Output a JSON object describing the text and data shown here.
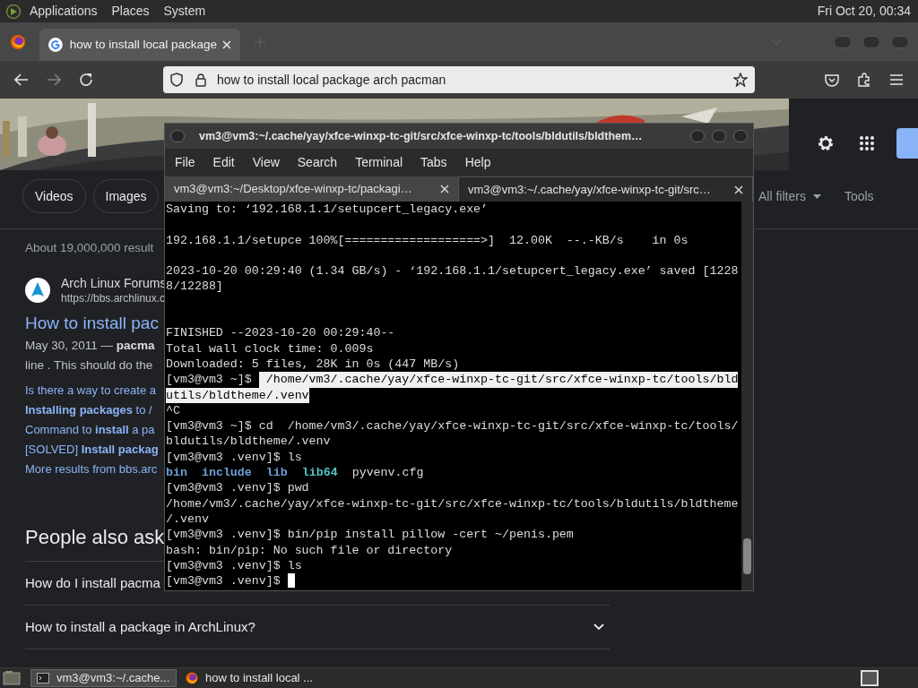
{
  "top_panel": {
    "menus": [
      "Applications",
      "Places",
      "System"
    ],
    "clock": "Fri Oct 20, 00:34"
  },
  "browser": {
    "tabs": [
      {
        "title": "how to install local package",
        "selected": true
      }
    ],
    "address": "how to install local package arch pacman",
    "page": {
      "chips": [
        "Videos",
        "Images"
      ],
      "filters": [
        "All filters",
        "Tools"
      ],
      "result_stats": "About 19,000,000 result",
      "result": {
        "site": "Arch Linux Forums",
        "url": "https://bbs.archlinux.c",
        "title": "How to install pac",
        "snippet": [
          "May 30, 2011 — **pacma**",
          "line . This should do the"
        ],
        "sitelinks": [
          "Is there a way to create a",
          "**Installing packages** to /",
          "Command to **install** a pa",
          "[SOLVED] **Install packag**",
          "More results from bbs.arc"
        ]
      },
      "people_also_ask": {
        "heading": "People also ask",
        "questions": [
          {
            "kind": "covered",
            "text": "How do I install pacma"
          },
          {
            "kind": "full",
            "text": "How to install a package in ArchLinux?"
          }
        ]
      }
    }
  },
  "terminal": {
    "title": "vm3@vm3:~/.cache/yay/xfce-winxp-tc-git/src/xfce-winxp-tc/tools/bldutils/bldthem…",
    "menus": [
      "File",
      "Edit",
      "View",
      "Search",
      "Terminal",
      "Tabs",
      "Help"
    ],
    "tabs": [
      {
        "title": "vm3@vm3:~/Desktop/xfce-winxp-tc/packagi…",
        "selected": false
      },
      {
        "title": "vm3@vm3:~/.cache/yay/xfce-winxp-tc-git/src…",
        "selected": true
      }
    ],
    "lines": [
      {
        "kind": "text",
        "segments": [
          {
            "kind": "plain",
            "text": "Saving to: ‘192.168.1.1/setupcert_legacy.exe’"
          }
        ]
      },
      {
        "kind": "blank"
      },
      {
        "kind": "text",
        "segments": [
          {
            "kind": "plain",
            "text": "192.168.1.1/setupce 100%[===================>]  12.00K  --.-KB/s    in 0s"
          }
        ]
      },
      {
        "kind": "blank"
      },
      {
        "kind": "text",
        "segments": [
          {
            "kind": "plain",
            "text": "2023-10-20 00:29:40 (1.34 GB/s) - ‘192.168.1.1/setupcert_legacy.exe’ saved [1228"
          }
        ]
      },
      {
        "kind": "text",
        "segments": [
          {
            "kind": "plain",
            "text": "8/12288]"
          }
        ]
      },
      {
        "kind": "blank"
      },
      {
        "kind": "blank"
      },
      {
        "kind": "text",
        "segments": [
          {
            "kind": "plain",
            "text": "FINISHED --2023-10-20 00:29:40--"
          }
        ]
      },
      {
        "kind": "text",
        "segments": [
          {
            "kind": "plain",
            "text": "Total wall clock time: 0.009s"
          }
        ]
      },
      {
        "kind": "text",
        "segments": [
          {
            "kind": "plain",
            "text": "Downloaded: 5 files, 28K in 0s (447 MB/s)"
          }
        ]
      },
      {
        "kind": "text",
        "segments": [
          {
            "kind": "plain",
            "text": "[vm3@vm3 ~]$ "
          },
          {
            "kind": "selected",
            "text": " /home/vm3/.cache/yay/xfce-winxp-tc-git/src/xfce-winxp-tc/tools/bld"
          }
        ]
      },
      {
        "kind": "text",
        "segments": [
          {
            "kind": "selected",
            "text": "utils/bldtheme/.venv"
          }
        ]
      },
      {
        "kind": "text",
        "segments": [
          {
            "kind": "plain",
            "text": "^C"
          }
        ]
      },
      {
        "kind": "text",
        "segments": [
          {
            "kind": "plain",
            "text": "[vm3@vm3 ~]$ cd  /home/vm3/.cache/yay/xfce-winxp-tc-git/src/xfce-winxp-tc/tools/"
          }
        ]
      },
      {
        "kind": "text",
        "segments": [
          {
            "kind": "plain",
            "text": "bldutils/bldtheme/.venv"
          }
        ]
      },
      {
        "kind": "text",
        "segments": [
          {
            "kind": "plain",
            "text": "[vm3@vm3 .venv]$ ls"
          }
        ]
      },
      {
        "kind": "text",
        "segments": [
          {
            "kind": "dir",
            "text": "bin"
          },
          {
            "kind": "dir",
            "text": "include"
          },
          {
            "kind": "dir",
            "text": "lib"
          },
          {
            "kind": "link",
            "text": "lib64"
          },
          {
            "kind": "plain",
            "text": "pyvenv.cfg"
          }
        ]
      },
      {
        "kind": "text",
        "segments": [
          {
            "kind": "plain",
            "text": "[vm3@vm3 .venv]$ pwd"
          }
        ]
      },
      {
        "kind": "text",
        "segments": [
          {
            "kind": "plain",
            "text": "/home/vm3/.cache/yay/xfce-winxp-tc-git/src/xfce-winxp-tc/tools/bldutils/bldtheme"
          }
        ]
      },
      {
        "kind": "text",
        "segments": [
          {
            "kind": "plain",
            "text": "/.venv"
          }
        ]
      },
      {
        "kind": "text",
        "segments": [
          {
            "kind": "plain",
            "text": "[vm3@vm3 .venv]$ bin/pip install pillow -cert ~/penis.pem"
          }
        ]
      },
      {
        "kind": "text",
        "segments": [
          {
            "kind": "plain",
            "text": "bash: bin/pip: No such file or directory"
          }
        ]
      },
      {
        "kind": "text",
        "segments": [
          {
            "kind": "plain",
            "text": "[vm3@vm3 .venv]$ ls"
          }
        ]
      },
      {
        "kind": "text",
        "cursor": true,
        "segments": [
          {
            "kind": "plain",
            "text": "[vm3@vm3 .venv]$ "
          }
        ]
      }
    ]
  },
  "taskbar": {
    "tasks": [
      {
        "kind": "terminal",
        "label": "vm3@vm3:~/.cache...",
        "selected": true
      },
      {
        "kind": "browser",
        "label": "how to install local ...",
        "selected": false
      }
    ]
  }
}
